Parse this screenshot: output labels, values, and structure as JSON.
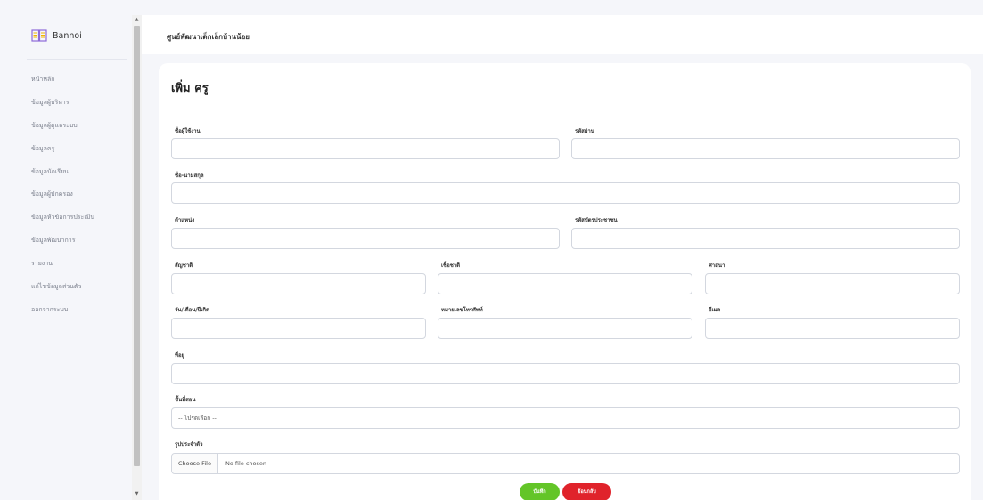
{
  "brand": {
    "name": "Bannoi",
    "icon": "book-open-icon"
  },
  "sidebar": {
    "items": [
      {
        "label": "หน้าหลัก"
      },
      {
        "label": "ข้อมูลผู้บริหาร"
      },
      {
        "label": "ข้อมูลผู้ดูแลระบบ"
      },
      {
        "label": "ข้อมูลครู"
      },
      {
        "label": "ข้อมูลนักเรียน"
      },
      {
        "label": "ข้อมูลผู้ปกครอง"
      },
      {
        "label": "ข้อมูลหัวข้อการประเมิน"
      },
      {
        "label": "ข้อมูลพัฒนาการ"
      },
      {
        "label": "รายงาน"
      },
      {
        "label": "แก้ไขข้อมูลส่วนตัว"
      },
      {
        "label": "ออกจากระบบ"
      }
    ]
  },
  "header": {
    "title": "ศูนย์พัฒนาเด็กเล็กบ้านน้อย"
  },
  "form": {
    "title": "เพิ่ม ครู",
    "username": {
      "label": "ชื่อผู้ใช้งาน",
      "value": ""
    },
    "password": {
      "label": "รหัสผ่าน",
      "value": ""
    },
    "fullname": {
      "label": "ชื่อ-นามสกุล",
      "value": ""
    },
    "position": {
      "label": "ตำแหน่ง",
      "value": ""
    },
    "id_card": {
      "label": "รหัสบัตรประชาชน",
      "value": ""
    },
    "ethnicity": {
      "label": "สัญชาติ",
      "value": ""
    },
    "race": {
      "label": "เชื้อชาติ",
      "value": ""
    },
    "religion": {
      "label": "ศาสนา",
      "value": ""
    },
    "birthdate": {
      "label": "วัน/เดือน/ปีเกิด",
      "value": ""
    },
    "phone": {
      "label": "หมายเลขโทรศัพท์",
      "value": ""
    },
    "email": {
      "label": "อีเมล",
      "value": ""
    },
    "address": {
      "label": "ที่อยู่",
      "value": ""
    },
    "class_level": {
      "label": "ชั้นที่สอน",
      "selected": "-- โปรดเลือก --"
    },
    "photo": {
      "label": "รูปประจำตัว",
      "button": "Choose File",
      "status": "No file chosen"
    },
    "save_label": "บันทึก",
    "back_label": "ย้อนกลับ"
  },
  "colors": {
    "save": "#63c528",
    "back": "#e0232b",
    "background": "#f5f6fa",
    "card": "#ffffff"
  }
}
